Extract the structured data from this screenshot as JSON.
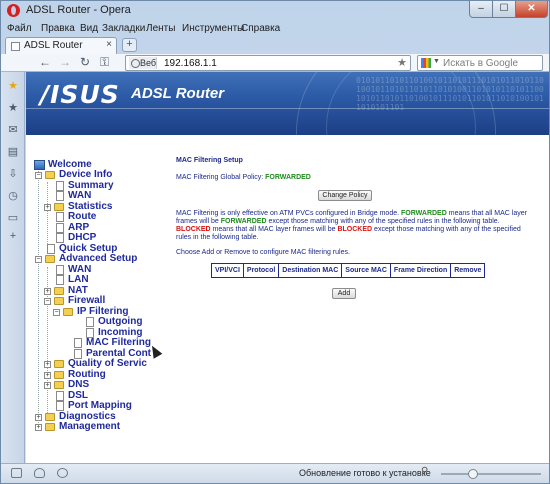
{
  "window": {
    "title": "ADSL Router - Opera",
    "min": "–",
    "max": "☐",
    "close": "✕"
  },
  "menu": [
    "Файл",
    "Правка",
    "Вид",
    "Закладки",
    "Ленты",
    "Инструменты",
    "Справка"
  ],
  "tabs": [
    {
      "label": "ADSL Router",
      "close": "×"
    }
  ],
  "newtab_label": "+",
  "nav": {
    "back": "←",
    "forward": "→",
    "reload": "↻",
    "home": "⚿",
    "web_badge": "Веб",
    "url": "192.168.1.1",
    "search_placeholder": "Искать в Google",
    "search_engine": "google-icon"
  },
  "side_panel": [
    "bookmarks-star-icon",
    "favorites-icon",
    "mail-icon",
    "notes-icon",
    "downloads-icon",
    "history-icon",
    "panels-icon",
    "add-panel-icon"
  ],
  "banner": {
    "brand": "/ISUS",
    "product": "ADSL Router",
    "bits": "0101011010110100101101011101010110101101001011010110101101010011010101101011001010110101101001011101011010110101001011010101101"
  },
  "tree": {
    "welcome": "Welcome",
    "device_info": "Device Info",
    "summary": "Summary",
    "wan": "WAN",
    "statistics": "Statistics",
    "route": "Route",
    "arp": "ARP",
    "dhcp": "DHCP",
    "quick_setup": "Quick Setup",
    "advanced_setup": "Advanced Setup",
    "adv_wan": "WAN",
    "lan": "LAN",
    "nat": "NAT",
    "firewall": "Firewall",
    "ip_filtering": "IP Filtering",
    "outgoing": "Outgoing",
    "incoming": "Incoming",
    "mac_filtering": "MAC Filtering",
    "parental": "Parental Cont",
    "qos": "Quality of Servic",
    "routing": "Routing",
    "dns": "DNS",
    "dsl": "DSL",
    "port_mapping": "Port Mapping",
    "diagnostics": "Diagnostics",
    "management": "Management"
  },
  "main": {
    "heading": "MAC Filtering Setup",
    "policy_label": "MAC Filtering Global Policy:",
    "policy_value": "FORWARDED",
    "change_policy": "Change Policy",
    "para1_a": "MAC Filtering is only effective on ATM PVCs configured in Bridge mode.",
    "para1_fw": "FORWARDED",
    "para1_b": "means that all MAC layer frames will be",
    "para1_fw2": "FORWARDED",
    "para1_c": "except those matching with any of the specified rules in the following table.",
    "para1_bl": "BLOCKED",
    "para1_d": "means that all MAC layer frames will be",
    "para1_bl2": "BLOCKED",
    "para1_e": "except those matching with any of the specified rules in the following table.",
    "para2": "Choose Add or Remove to configure MAC filtering rules.",
    "table_headers": [
      "VPI/VCI",
      "Protocol",
      "Destination MAC",
      "Source MAC",
      "Frame Direction",
      "Remove"
    ],
    "add": "Add"
  },
  "status": {
    "text": "Обновление готово к установке",
    "zoom_icon": "zoom-icon",
    "zoom_level": 0.3
  }
}
